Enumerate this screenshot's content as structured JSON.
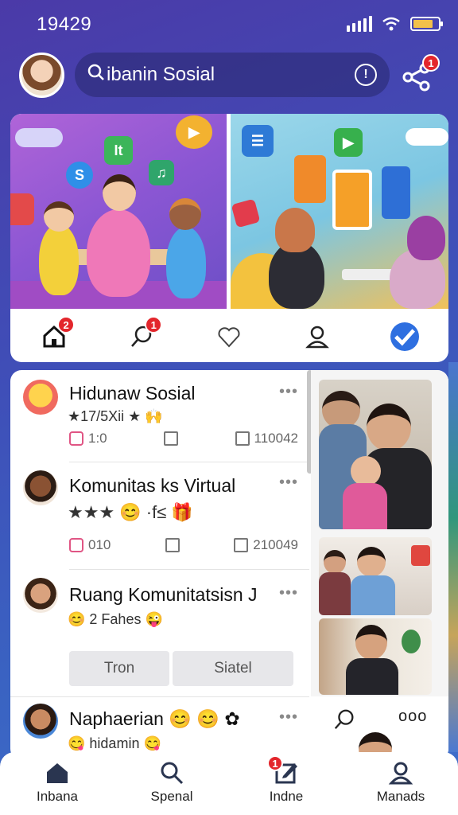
{
  "status": {
    "time": "19429"
  },
  "header": {
    "search_text": "ibanin Sosial",
    "share_badge": "1"
  },
  "hero": {
    "home_badge": "2",
    "comment_badge": "1",
    "left_tiles": [
      "It",
      "S",
      "♫"
    ],
    "right_tiles": [
      "☰",
      "▶"
    ]
  },
  "feed": {
    "posts": [
      {
        "title": "Hidunaw Sosial",
        "sub": "★17/5Xii ★ 🙌",
        "stat1": "1:0",
        "stat3": "110042"
      },
      {
        "title": "Komunitas ks Virtual",
        "sub": "★★★ 😊 ·f≤ 🎁",
        "stat1": "010",
        "stat3": "210049"
      },
      {
        "title": "Ruang Komunitatsisn J",
        "sub": "😊 2 Fahes 😜",
        "button1": "Tron",
        "button2": "Siatel"
      },
      {
        "title": "Naphaerian 😊 😊 ✿",
        "sub": "😋 hidamin 😋"
      }
    ]
  },
  "nav": {
    "items": [
      {
        "label": "Inbana",
        "icon": "home-icon"
      },
      {
        "label": "Spenal",
        "icon": "search-icon"
      },
      {
        "label": "Indne",
        "icon": "edit-icon",
        "badge": "1"
      },
      {
        "label": "Manads",
        "icon": "profile-icon"
      }
    ]
  }
}
